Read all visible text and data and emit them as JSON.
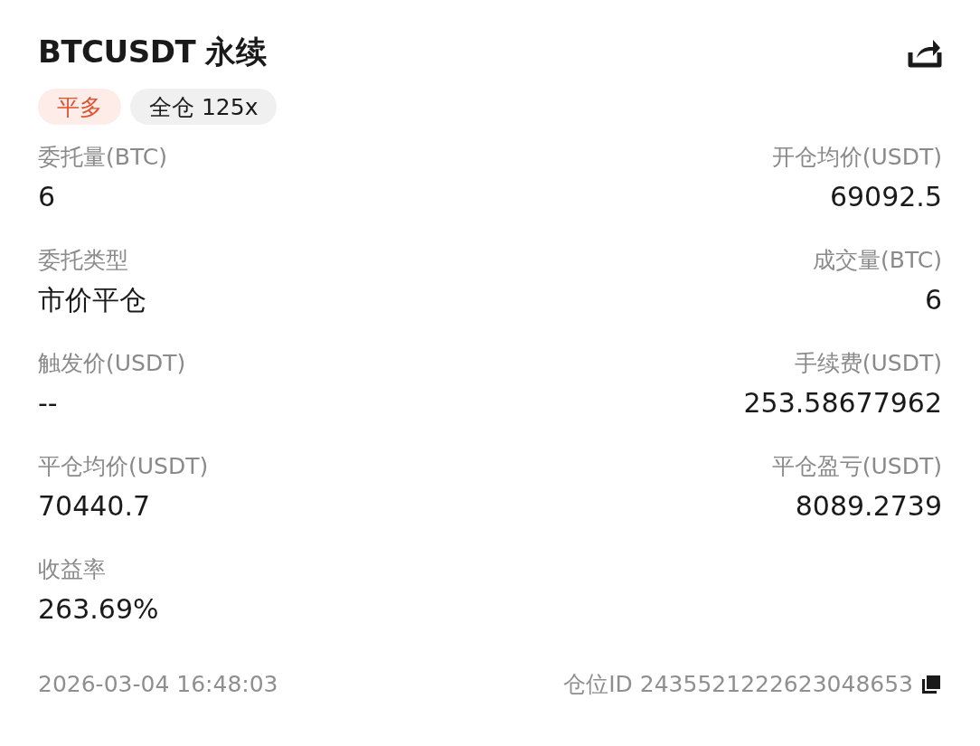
{
  "title": "BTCUSDT 永续",
  "tags": [
    {
      "label": "平多",
      "kind": "side"
    },
    {
      "label": "全仓 125x",
      "kind": "margin"
    }
  ],
  "left_fields": [
    {
      "label": "委托量(BTC)",
      "value": "6"
    },
    {
      "label": "委托类型",
      "value": "市价平仓"
    },
    {
      "label": "触发价(USDT)",
      "value": "--"
    },
    {
      "label": "平仓均价(USDT)",
      "value": "70440.7"
    },
    {
      "label": "收益率",
      "value": "263.69%"
    }
  ],
  "right_fields": [
    {
      "label": "开仓均价(USDT)",
      "value": "69092.5"
    },
    {
      "label": "成交量(BTC)",
      "value": "6"
    },
    {
      "label": "手续费(USDT)",
      "value": "253.58677962"
    },
    {
      "label": "平仓盈亏(USDT)",
      "value": "8089.2739"
    }
  ],
  "footer": {
    "time": "2026-03-04 16:48:03",
    "position_id": "仓位ID 2435521222623048653"
  }
}
